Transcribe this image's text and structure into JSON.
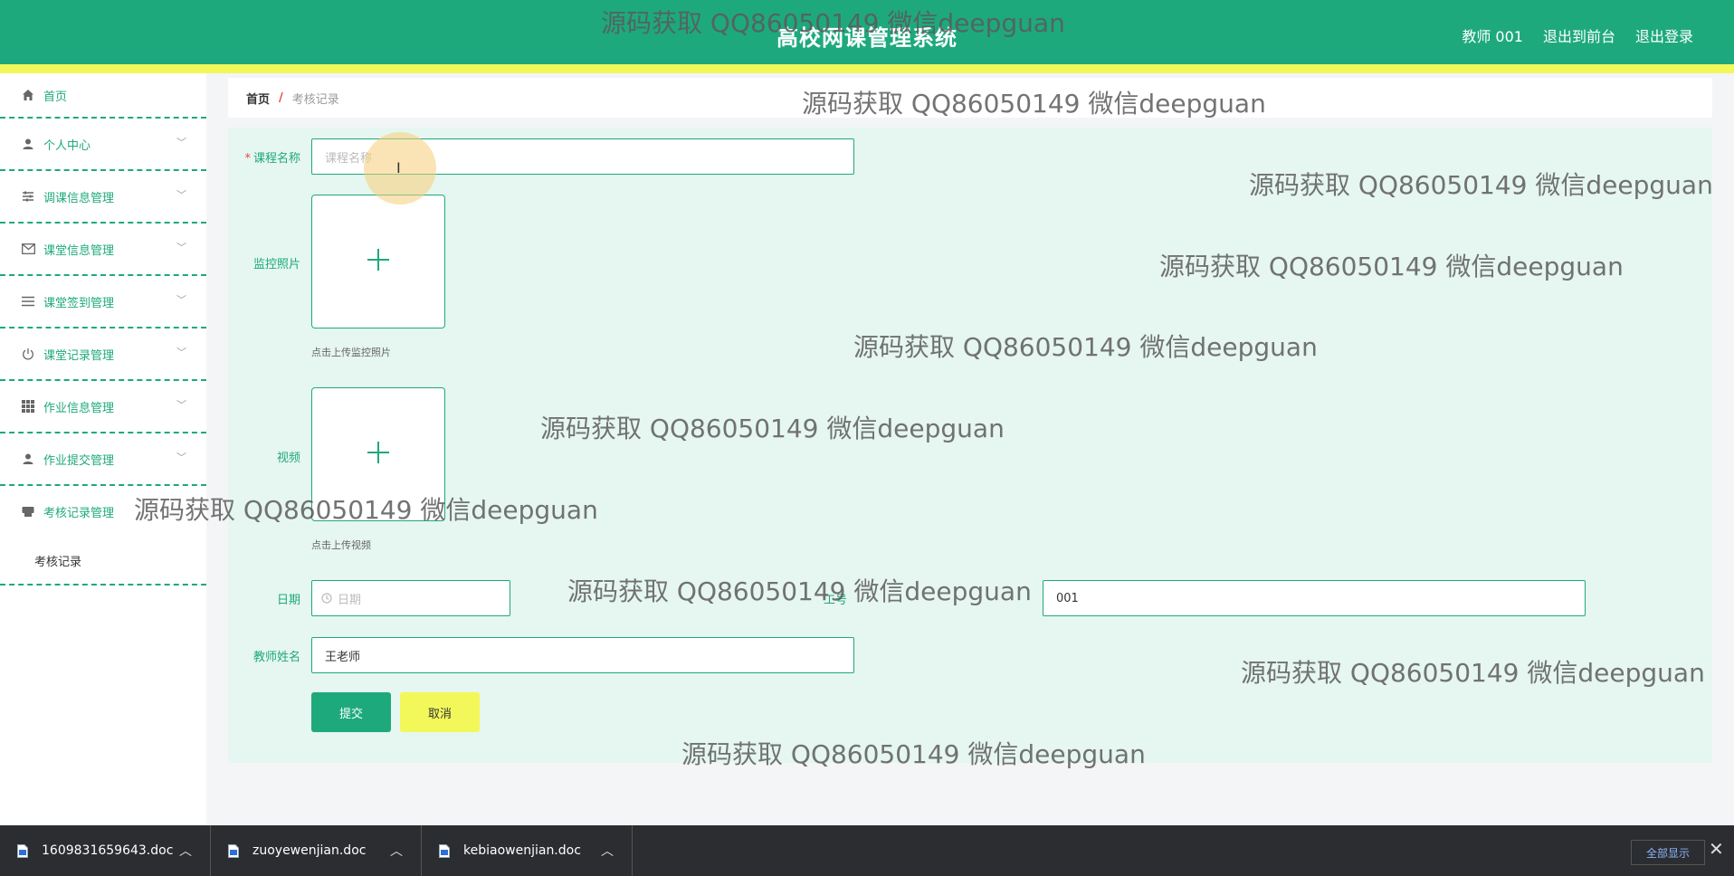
{
  "header": {
    "title": "高校网课管理系统",
    "user": "教师 001",
    "front_link": "退出到前台",
    "logout_link": "退出登录"
  },
  "sidebar": {
    "items": [
      {
        "label": "首页",
        "icon": "home-icon"
      },
      {
        "label": "个人中心",
        "icon": "user-icon"
      },
      {
        "label": "调课信息管理",
        "icon": "sliders-icon"
      },
      {
        "label": "课堂信息管理",
        "icon": "mail-icon"
      },
      {
        "label": "课堂签到管理",
        "icon": "list-icon"
      },
      {
        "label": "课堂记录管理",
        "icon": "power-icon"
      },
      {
        "label": "作业信息管理",
        "icon": "grid-icon"
      },
      {
        "label": "作业提交管理",
        "icon": "user-icon"
      },
      {
        "label": "考核记录管理",
        "icon": "printer-icon"
      }
    ],
    "subitem": "考核记录"
  },
  "breadcrumb": {
    "home": "首页",
    "separator": "/",
    "current": "考核记录"
  },
  "form": {
    "course_label": "课程名称",
    "course_placeholder": "课程名称",
    "photo_label": "监控照片",
    "photo_tip": "点击上传监控照片",
    "video_label": "视频",
    "video_tip": "点击上传视频",
    "date_label": "日期",
    "date_placeholder": "日期",
    "worker_label": "工号",
    "worker_value": "001",
    "teacher_label": "教师姓名",
    "teacher_value": "王老师",
    "submit": "提交",
    "cancel": "取消"
  },
  "watermark": "源码获取 QQ86050149 微信deepguan",
  "downloads": {
    "files": [
      "1609831659643.doc",
      "zuoyewenjian.doc",
      "kebiaowenjian.doc"
    ],
    "show_all": "全部显示",
    "close": "✕"
  },
  "colors": {
    "primary": "#1ea97c",
    "accent_yellow": "#f3f85a",
    "form_bg": "#e6f6f0"
  }
}
